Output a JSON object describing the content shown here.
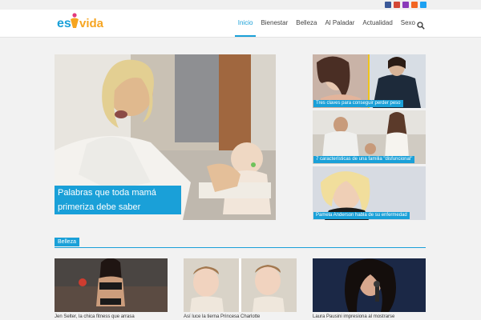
{
  "brand": {
    "logo_text_a": "es",
    "logo_text_b": "vida"
  },
  "social_icons": [
    {
      "name": "facebook-icon",
      "color": "#3b5998"
    },
    {
      "name": "google-plus-icon",
      "color": "#d34836"
    },
    {
      "name": "instagram-icon",
      "color": "#8a3ab9"
    },
    {
      "name": "rss-icon",
      "color": "#f26522"
    },
    {
      "name": "twitter-icon",
      "color": "#1da1f2"
    }
  ],
  "nav": {
    "items": [
      {
        "label": "Inicio",
        "active": true
      },
      {
        "label": "Bienestar"
      },
      {
        "label": "Belleza"
      },
      {
        "label": "Al Paladar"
      },
      {
        "label": "Actualidad"
      },
      {
        "label": "Sexo"
      }
    ]
  },
  "hero": {
    "caption": "Palabras que toda mamá primeriza debe saber"
  },
  "side_cards": [
    {
      "caption": "Tres claves para conseguir perder peso"
    },
    {
      "caption": "7 características de una familia \"disfuncional\""
    },
    {
      "caption": "Pamela Anderson habla de su enfermedad"
    }
  ],
  "section": {
    "label": "Belleza"
  },
  "bottom_cards": [
    {
      "title": "Jen Selter, la chica fitness que arrasa"
    },
    {
      "title": "Así luce la tierna Princesa Charlotte"
    },
    {
      "title": "Laura Pausini impresiona al mostrarse"
    }
  ],
  "colors": {
    "accent": "#1aa0d8"
  }
}
